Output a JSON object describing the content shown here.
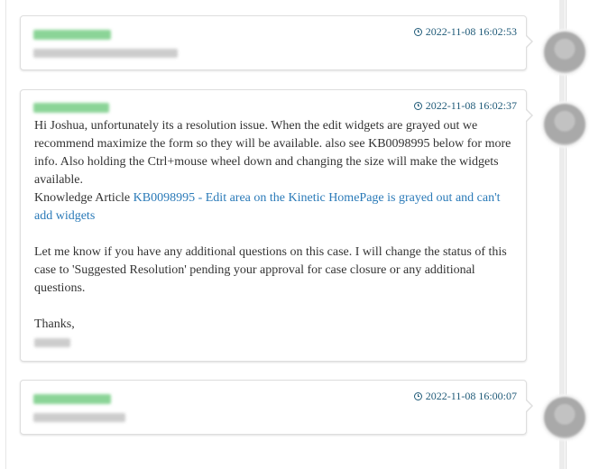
{
  "entries": [
    {
      "timestamp": "2022-11-08 16:02:53"
    },
    {
      "timestamp": "2022-11-08 16:02:37",
      "body": {
        "para1": " Hi Joshua,  unfortunately its a resolution issue.   When the edit widgets are grayed out we recommend maximize the form so they will be available. also see KB0098995 below for more info.  Also holding the Ctrl+mouse wheel down and changing the size will make the widgets available.",
        "kb_prefix": "Knowledge Article ",
        "kb_link": "KB0098995 - Edit area on the Kinetic HomePage is grayed out and can't add widgets",
        "para2": "Let me know if you have any additional questions on this case.  I will change the status of this case to 'Suggested Resolution' pending your approval for case closure or any additional questions.",
        "signoff": "Thanks,"
      }
    },
    {
      "timestamp": "2022-11-08 16:00:07"
    }
  ],
  "colors": {
    "timestamp": "#1f5a78",
    "link": "#2a7ab8",
    "author_blur": "#7fd08c"
  },
  "icons": {
    "timestamp_icon": "clock-icon",
    "avatar": "avatar"
  }
}
